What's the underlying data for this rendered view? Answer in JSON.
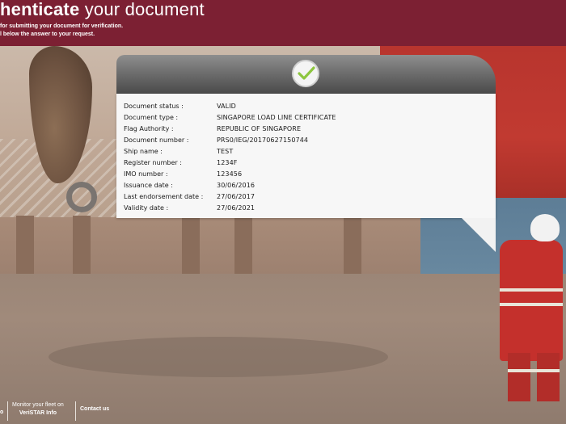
{
  "header": {
    "title_bold": "henticate",
    "title_light": "your document",
    "subtitle_line1": "for submitting your document for verification.",
    "subtitle_line2": "l below the answer to your request."
  },
  "card": {
    "status_icon": "check-icon",
    "status_color": "#8dc63f",
    "rows": [
      {
        "label": "Document status :",
        "value": "VALID"
      },
      {
        "label": "Document type :",
        "value": "SINGAPORE LOAD LINE CERTIFICATE"
      },
      {
        "label": "Flag Authority :",
        "value": "REPUBLIC OF SINGAPORE"
      },
      {
        "label": "Document number :",
        "value": "PRS0/IEG/20170627150744"
      },
      {
        "label": "Ship name :",
        "value": "TEST"
      },
      {
        "label": "Register number :",
        "value": "1234F"
      },
      {
        "label": "IMO number :",
        "value": "123456"
      },
      {
        "label": "Issuance date :",
        "value": "30/06/2016"
      },
      {
        "label": "Last endorsement date :",
        "value": "27/06/2017"
      },
      {
        "label": "Validity date :",
        "value": "27/06/2021"
      }
    ]
  },
  "footer": {
    "partial_link": "o",
    "monitor_line1": "Monitor your fleet on",
    "monitor_line2": "VeriSTAR Info",
    "contact": "Contact us"
  },
  "colors": {
    "header_bg": "#7c2033"
  }
}
